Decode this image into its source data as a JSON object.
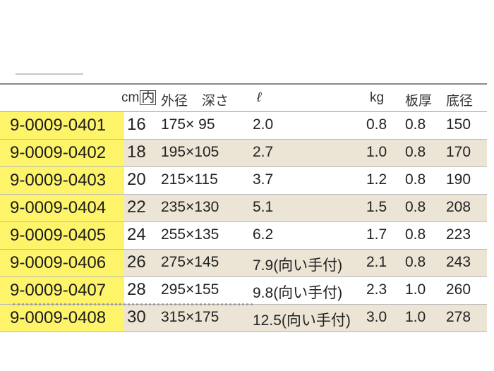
{
  "header": {
    "cm": "cm",
    "inner": "内",
    "outer": "外径",
    "depth": "深さ",
    "capacity": "ℓ",
    "weight": "kg",
    "plate": "板厚",
    "base": "底径"
  },
  "rows": [
    {
      "code": "9-0009-0401",
      "cm": "16",
      "dim": "175× 95",
      "cap": "2.0",
      "kg": "0.8",
      "plate": "0.8",
      "base": "150"
    },
    {
      "code": "9-0009-0402",
      "cm": "18",
      "dim": "195×105",
      "cap": "2.7",
      "kg": "1.0",
      "plate": "0.8",
      "base": "170"
    },
    {
      "code": "9-0009-0403",
      "cm": "20",
      "dim": "215×115",
      "cap": "3.7",
      "kg": "1.2",
      "plate": "0.8",
      "base": "190"
    },
    {
      "code": "9-0009-0404",
      "cm": "22",
      "dim": "235×130",
      "cap": "5.1",
      "kg": "1.5",
      "plate": "0.8",
      "base": "208"
    },
    {
      "code": "9-0009-0405",
      "cm": "24",
      "dim": "255×135",
      "cap": "6.2",
      "kg": "1.7",
      "plate": "0.8",
      "base": "223"
    },
    {
      "code": "9-0009-0406",
      "cm": "26",
      "dim": "275×145",
      "cap": "7.9(向い手付)",
      "kg": "2.1",
      "plate": "0.8",
      "base": "243"
    },
    {
      "code": "9-0009-0407",
      "cm": "28",
      "dim": "295×155",
      "cap": "9.8(向い手付)",
      "kg": "2.3",
      "plate": "1.0",
      "base": "260"
    },
    {
      "code": "9-0009-0408",
      "cm": "30",
      "dim": "315×175",
      "cap": "12.5(向い手付)",
      "kg": "3.0",
      "plate": "1.0",
      "base": "278"
    }
  ]
}
